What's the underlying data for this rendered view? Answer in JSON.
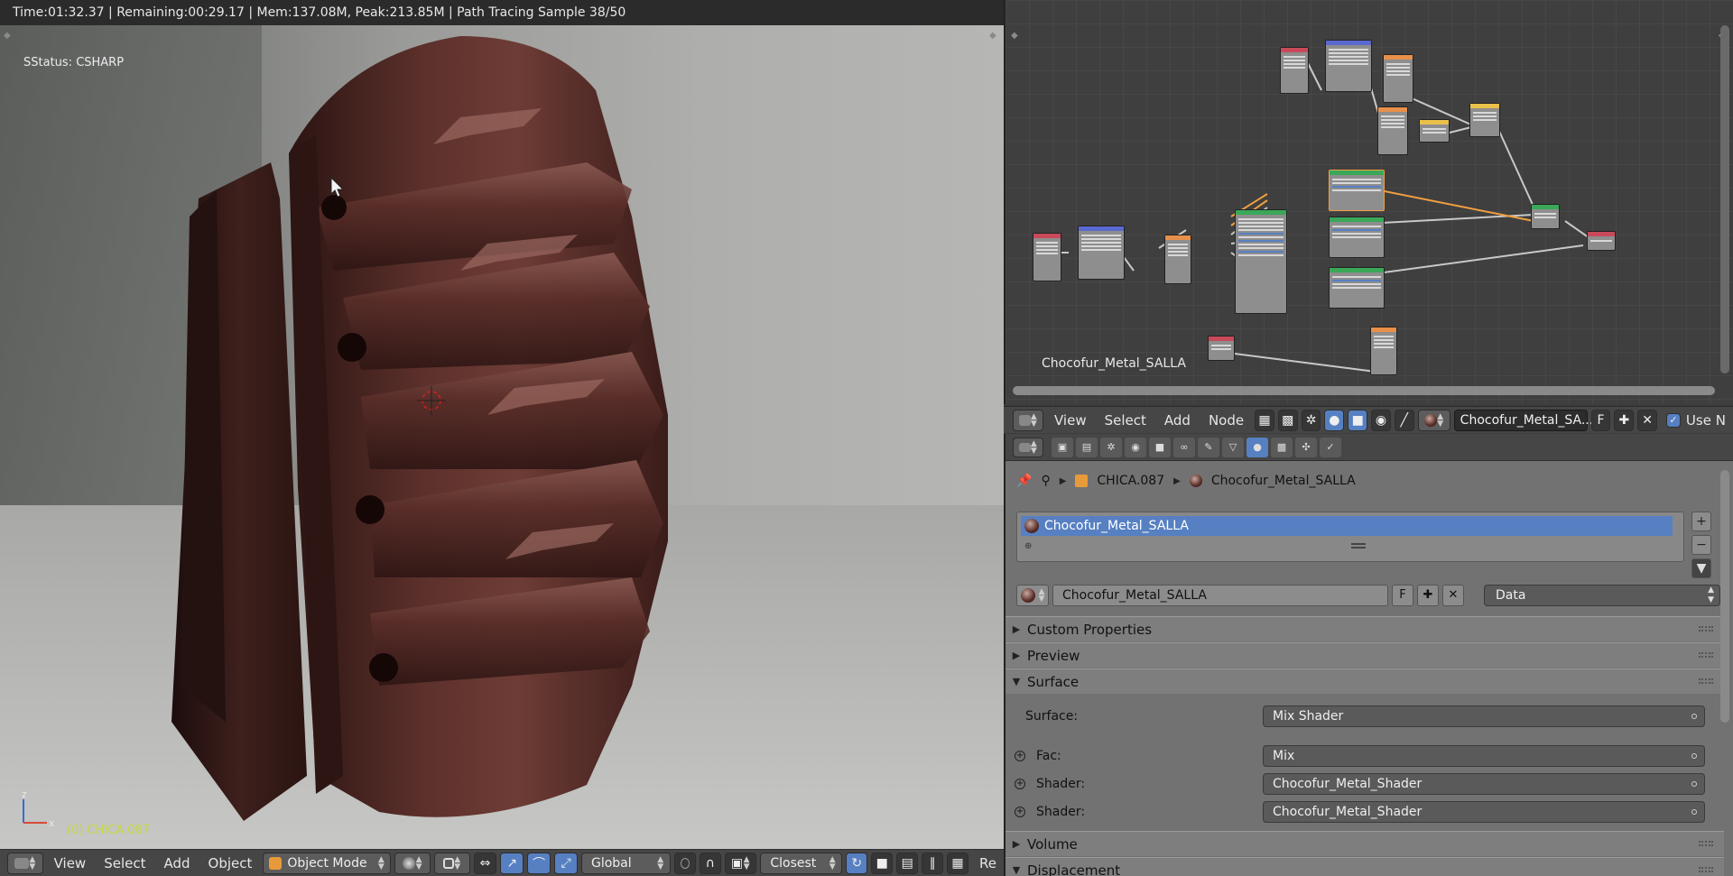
{
  "viewport": {
    "render_status": "Time:01:32.37 | Remaining:00:29.17 | Mem:137.08M, Peak:213.85M | Path Tracing Sample 38/50",
    "hud_status": "SStatus: CSHARP",
    "object_label": "(0) CHICA.087",
    "axis_z": "z",
    "axis_x": "x",
    "header": {
      "menus": [
        "View",
        "Select",
        "Add",
        "Object"
      ],
      "mode": "Object Mode",
      "orientation": "Global",
      "snap_target": "Closest",
      "trailing": "Re"
    }
  },
  "node_editor": {
    "material_name": "Chocofur_Metal_SALLA",
    "header": {
      "menus": [
        "View",
        "Select",
        "Add",
        "Node"
      ],
      "material_field": "Chocofur_Metal_SA...",
      "fake_user": "F",
      "use_nodes_label": "Use N"
    }
  },
  "properties": {
    "breadcrumb": {
      "object": "CHICA.087",
      "material": "Chocofur_Metal_SALLA"
    },
    "slot_item": "Chocofur_Metal_SALLA",
    "datablock": {
      "name": "Chocofur_Metal_SALLA",
      "fake_user": "F",
      "link": "Data"
    },
    "panels": {
      "custom_properties": "Custom Properties",
      "preview": "Preview",
      "surface": "Surface",
      "volume": "Volume",
      "displacement": "Displacement"
    },
    "surface": {
      "surface_label": "Surface:",
      "surface_value": "Mix Shader",
      "fac_label": "Fac:",
      "fac_value": "Mix",
      "shader1_label": "Shader:",
      "shader1_value": "Chocofur_Metal_Shader",
      "shader2_label": "Shader:",
      "shader2_value": "Chocofur_Metal_Shader"
    }
  },
  "colors": {
    "accent": "#5680c2",
    "object_label": "#c8d840",
    "node_selected": "#f0a040"
  }
}
